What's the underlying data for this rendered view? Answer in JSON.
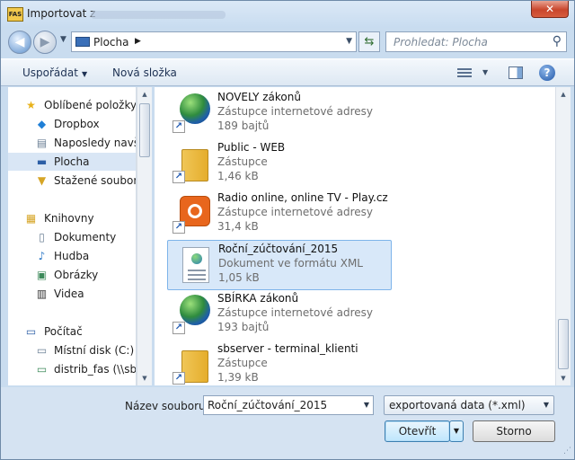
{
  "window": {
    "title": "Importovat z",
    "close_label": "✕"
  },
  "nav": {
    "back_icon": "arrow-left-icon",
    "forward_icon": "arrow-right-icon"
  },
  "address": {
    "location": "Plocha",
    "separator": "▶"
  },
  "search": {
    "placeholder": "Prohledat: Plocha"
  },
  "toolbar": {
    "organize_label": "Uspořádat",
    "new_folder_label": "Nová složka"
  },
  "sidebar": {
    "items": [
      {
        "label": "Oblíbené položky",
        "icon": "star-icon"
      },
      {
        "label": "Dropbox",
        "icon": "dropbox-icon"
      },
      {
        "label": "Naposledy navštívená místa",
        "icon": "recent-places-icon"
      },
      {
        "label": "Plocha",
        "icon": "desktop-icon"
      },
      {
        "label": "Stažené soubory",
        "icon": "downloads-icon"
      },
      {
        "label": "Knihovny",
        "icon": "libraries-icon"
      },
      {
        "label": "Dokumenty",
        "icon": "documents-icon"
      },
      {
        "label": "Hudba",
        "icon": "music-icon"
      },
      {
        "label": "Obrázky",
        "icon": "pictures-icon"
      },
      {
        "label": "Videa",
        "icon": "videos-icon"
      },
      {
        "label": "Počítač",
        "icon": "computer-icon"
      },
      {
        "label": "Místní disk (C:)",
        "icon": "local-disk-icon"
      },
      {
        "label": "distrib_fas (\\\\sbserver)",
        "icon": "network-drive-icon"
      }
    ],
    "selected": "Plocha"
  },
  "files": [
    {
      "name": "NOVELY zákonů",
      "type": "Zástupce internetové adresy",
      "size": "189 bajtů",
      "icon": "globe-shortcut-icon"
    },
    {
      "name": "Public - WEB",
      "type": "Zástupce",
      "size": "1,46 kB",
      "icon": "folder-shortcut-icon"
    },
    {
      "name": "Radio online, online TV - Play.cz",
      "type": "Zástupce internetové adresy",
      "size": "31,4 kB",
      "icon": "radio-shortcut-icon"
    },
    {
      "name": "Roční_zúčtování_2015",
      "type": "Dokument ve formátu XML",
      "size": "1,05 kB",
      "icon": "xml-document-icon"
    },
    {
      "name": "SBÍRKA zákonů",
      "type": "Zástupce internetové adresy",
      "size": "193 bajtů",
      "icon": "globe-shortcut-icon"
    },
    {
      "name": "sbserver - terminal_klienti",
      "type": "Zástupce",
      "size": "1,39 kB",
      "icon": "folder-shortcut-icon"
    }
  ],
  "selected_file": "Roční_zúčtování_2015",
  "filename": {
    "label": "Název souboru:",
    "value": "Roční_zúčtování_2015"
  },
  "filetype": {
    "value": "exportovaná data (*.xml)"
  },
  "buttons": {
    "open_label": "Otevřít",
    "cancel_label": "Storno"
  },
  "colors": {
    "selection": "#d8e8f9",
    "selection_border": "#7eb4ea",
    "frame": "#c9dcef"
  }
}
